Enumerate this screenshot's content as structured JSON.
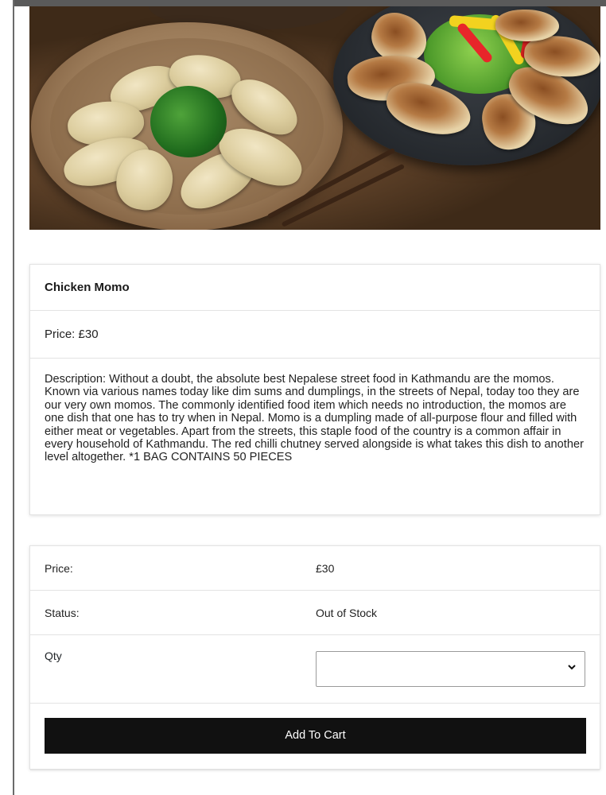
{
  "product": {
    "image_icon": "momo-dumplings-photo",
    "name": "Chicken Momo",
    "price_line": "Price: £30",
    "description": "Description: Without a doubt, the absolute best Nepalese street food in Kathmandu are the momos. Known via various names today like dim sums and dumplings, in the streets of Nepal, today too they are our very own momos. The commonly identified food item which needs no introduction, the momos are one dish that one has to try when in Nepal. Momo is a dumpling made of all-purpose flour and filled with either meat or vegetables. Apart from the streets, this staple food of the country is a common affair in every household of Kathmandu. The red chilli chutney served alongside is what takes this dish to another level altogether. *1 BAG CONTAINS 50 PIECES"
  },
  "cart": {
    "price_label": "Price:",
    "price_value": "£30",
    "status_label": "Status:",
    "status_value": "Out of Stock",
    "qty_label": "Qty",
    "qty_selected": "",
    "qty_icon": "chevron-down-icon",
    "add_to_cart_label": "Add To Cart"
  },
  "colors": {
    "button_bg": "#111111",
    "button_text": "#ffffff",
    "border": "#e3e3e3"
  }
}
